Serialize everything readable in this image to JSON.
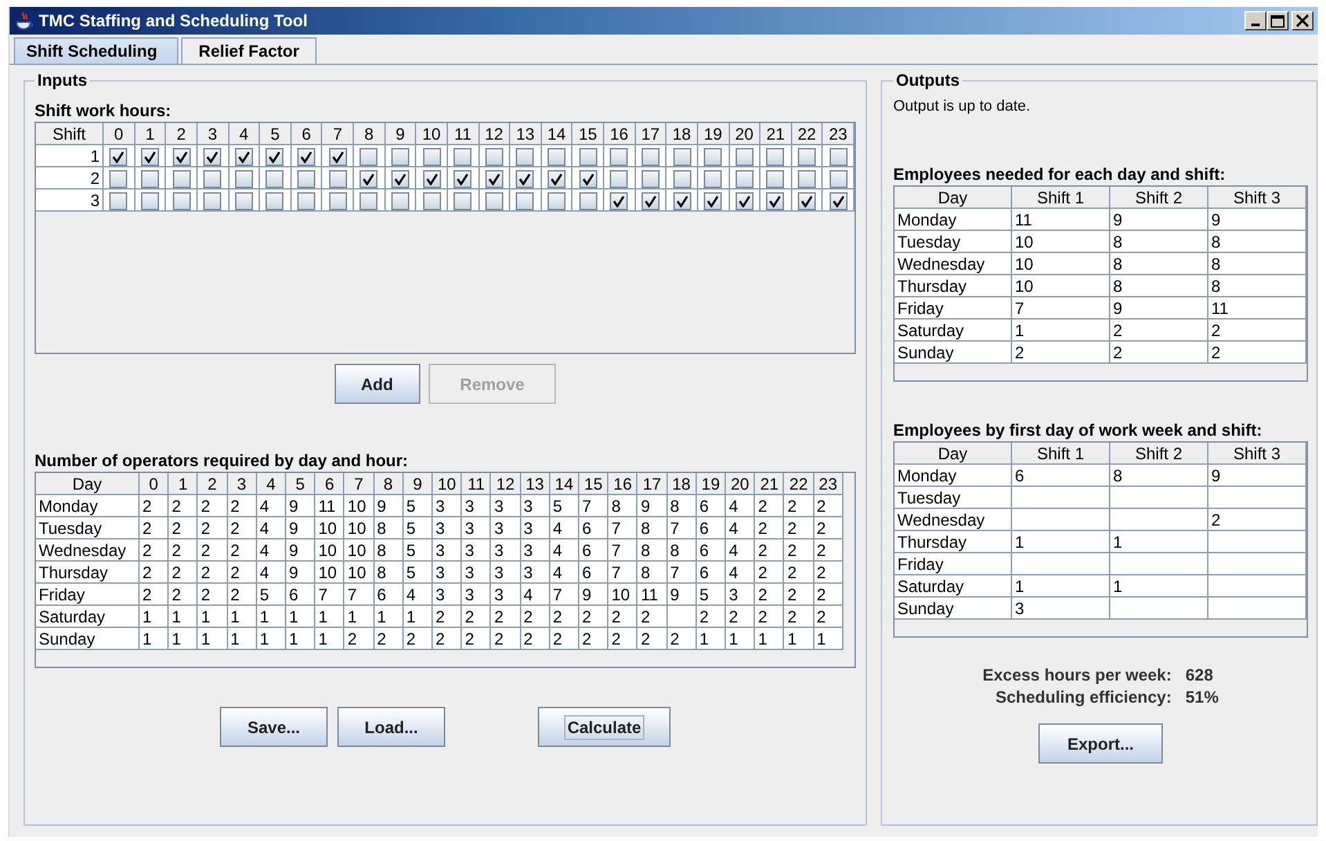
{
  "window": {
    "title": "TMC Staffing and Scheduling Tool"
  },
  "tabs": [
    {
      "label": "Shift Scheduling",
      "selected": true
    },
    {
      "label": "Relief Factor",
      "selected": false
    }
  ],
  "inputs": {
    "title": "Inputs",
    "shift_hours": {
      "label": "Shift work hours:",
      "columns": [
        "Shift",
        "0",
        "1",
        "2",
        "3",
        "4",
        "5",
        "6",
        "7",
        "8",
        "9",
        "10",
        "11",
        "12",
        "13",
        "14",
        "15",
        "16",
        "17",
        "18",
        "19",
        "20",
        "21",
        "22",
        "23"
      ],
      "rows": [
        {
          "shift": "1",
          "hours": [
            {
              "checked": true
            },
            {
              "checked": true
            },
            {
              "checked": true
            },
            {
              "checked": true
            },
            {
              "checked": true
            },
            {
              "checked": true
            },
            {
              "checked": true
            },
            {
              "checked": true
            },
            {
              "checked": false
            },
            {
              "checked": false
            },
            {
              "checked": false
            },
            {
              "checked": false
            },
            {
              "checked": false
            },
            {
              "checked": false
            },
            {
              "checked": false
            },
            {
              "checked": false
            },
            {
              "checked": false
            },
            {
              "checked": false
            },
            {
              "checked": false
            },
            {
              "checked": false
            },
            {
              "checked": false
            },
            {
              "checked": false
            },
            {
              "checked": false
            },
            {
              "checked": false
            }
          ]
        },
        {
          "shift": "2",
          "hours": [
            {
              "checked": false
            },
            {
              "checked": false
            },
            {
              "checked": false
            },
            {
              "checked": false
            },
            {
              "checked": false
            },
            {
              "checked": false
            },
            {
              "checked": false
            },
            {
              "checked": false
            },
            {
              "checked": true
            },
            {
              "checked": true
            },
            {
              "checked": true
            },
            {
              "checked": true
            },
            {
              "checked": true
            },
            {
              "checked": true
            },
            {
              "checked": true
            },
            {
              "checked": true
            },
            {
              "checked": false
            },
            {
              "checked": false
            },
            {
              "checked": false
            },
            {
              "checked": false
            },
            {
              "checked": false
            },
            {
              "checked": false
            },
            {
              "checked": false
            },
            {
              "checked": false
            }
          ]
        },
        {
          "shift": "3",
          "hours": [
            {
              "checked": false
            },
            {
              "checked": false
            },
            {
              "checked": false
            },
            {
              "checked": false
            },
            {
              "checked": false
            },
            {
              "checked": false
            },
            {
              "checked": false
            },
            {
              "checked": false
            },
            {
              "checked": false
            },
            {
              "checked": false
            },
            {
              "checked": false
            },
            {
              "checked": false
            },
            {
              "checked": false
            },
            {
              "checked": false
            },
            {
              "checked": false
            },
            {
              "checked": false
            },
            {
              "checked": true
            },
            {
              "checked": true
            },
            {
              "checked": true
            },
            {
              "checked": true
            },
            {
              "checked": true
            },
            {
              "checked": true
            },
            {
              "checked": true
            },
            {
              "checked": true
            }
          ]
        }
      ]
    },
    "shift_buttons": [
      {
        "label": "Add",
        "disabled": false
      },
      {
        "label": "Remove",
        "disabled": true
      }
    ],
    "operators": {
      "label": "Number of operators required by day and hour:",
      "columns": [
        "Day",
        "0",
        "1",
        "2",
        "3",
        "4",
        "5",
        "6",
        "7",
        "8",
        "9",
        "10",
        "11",
        "12",
        "13",
        "14",
        "15",
        "16",
        "17",
        "18",
        "19",
        "20",
        "21",
        "22",
        "23"
      ],
      "rows": [
        {
          "day": "Monday",
          "hours": {
            "0": "2",
            "1": "2",
            "2": "2",
            "3": "2",
            "4": "4",
            "5": "9",
            "6": "11",
            "7": "10",
            "8": "9",
            "9": "5",
            "10": "3",
            "11": "3",
            "12": "3",
            "13": "3",
            "14": "5",
            "15": "7",
            "16": "8",
            "17": "9",
            "18": "8",
            "19": "6",
            "20": "4",
            "21": "2",
            "22": "2",
            "23": "2"
          }
        },
        {
          "day": "Tuesday",
          "hours": {
            "0": "2",
            "1": "2",
            "2": "2",
            "3": "2",
            "4": "4",
            "5": "9",
            "6": "10",
            "7": "10",
            "8": "8",
            "9": "5",
            "10": "3",
            "11": "3",
            "12": "3",
            "13": "3",
            "14": "4",
            "15": "6",
            "16": "7",
            "17": "8",
            "18": "7",
            "19": "6",
            "20": "4",
            "21": "2",
            "22": "2",
            "23": "2"
          }
        },
        {
          "day": "Wednesday",
          "hours": {
            "0": "2",
            "1": "2",
            "2": "2",
            "3": "2",
            "4": "4",
            "5": "9",
            "6": "10",
            "7": "10",
            "8": "8",
            "9": "5",
            "10": "3",
            "11": "3",
            "12": "3",
            "13": "3",
            "14": "4",
            "15": "6",
            "16": "7",
            "17": "8",
            "18": "8",
            "19": "6",
            "20": "4",
            "21": "2",
            "22": "2",
            "23": "2"
          }
        },
        {
          "day": "Thursday",
          "hours": {
            "0": "2",
            "1": "2",
            "2": "2",
            "3": "2",
            "4": "4",
            "5": "9",
            "6": "10",
            "7": "10",
            "8": "8",
            "9": "5",
            "10": "3",
            "11": "3",
            "12": "3",
            "13": "3",
            "14": "4",
            "15": "6",
            "16": "7",
            "17": "8",
            "18": "7",
            "19": "6",
            "20": "4",
            "21": "2",
            "22": "2",
            "23": "2"
          }
        },
        {
          "day": "Friday",
          "hours": {
            "0": "2",
            "1": "2",
            "2": "2",
            "3": "2",
            "4": "5",
            "5": "6",
            "6": "7",
            "7": "7",
            "8": "6",
            "9": "4",
            "10": "3",
            "11": "3",
            "12": "3",
            "13": "4",
            "14": "7",
            "15": "9",
            "16": "10",
            "17": "11",
            "18": "9",
            "19": "5",
            "20": "3",
            "21": "2",
            "22": "2",
            "23": "2"
          }
        },
        {
          "day": "Saturday",
          "hours": {
            "0": "1",
            "1": "1",
            "2": "1",
            "3": "1",
            "4": "1",
            "5": "1",
            "6": "1",
            "7": "1",
            "8": "1",
            "9": "1",
            "10": "2",
            "11": "2",
            "12": "2",
            "13": "2",
            "14": "2",
            "15": "2",
            "16": "2",
            "17": "2",
            "19": "2",
            "20": "2",
            "21": "2",
            "22": "2",
            "23": "2"
          }
        },
        {
          "day": "Sunday",
          "hours": {
            "0": "1",
            "1": "1",
            "2": "1",
            "3": "1",
            "4": "1",
            "5": "1",
            "6": "1",
            "7": "2",
            "8": "2",
            "9": "2",
            "10": "2",
            "11": "2",
            "12": "2",
            "13": "2",
            "14": "2",
            "15": "2",
            "16": "2",
            "17": "2",
            "18": "2",
            "19": "1",
            "20": "1",
            "21": "1",
            "22": "1",
            "23": "1"
          }
        }
      ]
    },
    "buttons": [
      {
        "label": "Save...",
        "focused": false
      },
      {
        "label": "Load...",
        "focused": false
      },
      {
        "label": "Calculate",
        "focused": true
      }
    ]
  },
  "outputs": {
    "title": "Outputs",
    "status": "Output is up to date.",
    "tables": [
      {
        "label": "Employees needed for each day and shift:",
        "columns": [
          "Day",
          "Shift 1",
          "Shift 2",
          "Shift 3"
        ],
        "rows": [
          {
            "day": "Monday",
            "shift_1": "11",
            "shift_2": "9",
            "shift_3": "9"
          },
          {
            "day": "Tuesday",
            "shift_1": "10",
            "shift_2": "8",
            "shift_3": "8"
          },
          {
            "day": "Wednesday",
            "shift_1": "10",
            "shift_2": "8",
            "shift_3": "8"
          },
          {
            "day": "Thursday",
            "shift_1": "10",
            "shift_2": "8",
            "shift_3": "8"
          },
          {
            "day": "Friday",
            "shift_1": "7",
            "shift_2": "9",
            "shift_3": "11"
          },
          {
            "day": "Saturday",
            "shift_1": "1",
            "shift_2": "2",
            "shift_3": "2"
          },
          {
            "day": "Sunday",
            "shift_1": "2",
            "shift_2": "2",
            "shift_3": "2"
          }
        ]
      },
      {
        "label": "Employees by first day of work week and shift:",
        "columns": [
          "Day",
          "Shift 1",
          "Shift 2",
          "Shift 3"
        ],
        "rows": [
          {
            "day": "Monday",
            "shift_1": "6",
            "shift_2": "8",
            "shift_3": "9"
          },
          {
            "day": "Tuesday"
          },
          {
            "day": "Wednesday",
            "shift_3": "2"
          },
          {
            "day": "Thursday",
            "shift_1": "1",
            "shift_2": "1"
          },
          {
            "day": "Friday"
          },
          {
            "day": "Saturday",
            "shift_1": "1",
            "shift_2": "1"
          },
          {
            "day": "Sunday",
            "shift_1": "3"
          }
        ]
      }
    ],
    "stats": [
      {
        "label": "Excess hours per week:",
        "value": "628"
      },
      {
        "label": "Scheduling efficiency:",
        "value": "51%"
      }
    ],
    "export_button": {
      "label": "Export..."
    }
  }
}
